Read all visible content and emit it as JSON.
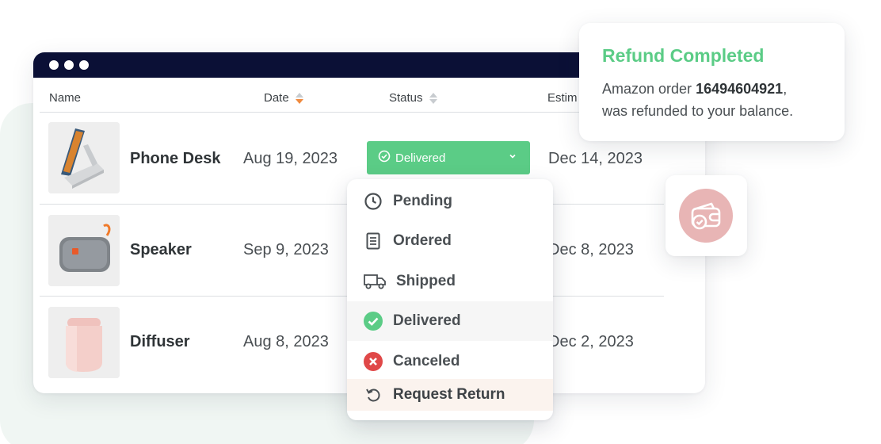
{
  "table": {
    "headers": {
      "name": "Name",
      "date": "Date",
      "status": "Status",
      "estimated": "Estim"
    },
    "rows": [
      {
        "name": "Phone Desk",
        "date": "Aug 19, 2023",
        "estimated": "Dec 14, 2023"
      },
      {
        "name": "Speaker",
        "date": "Sep 9, 2023",
        "estimated": "Dec 8, 2023"
      },
      {
        "name": "Diffuser",
        "date": "Aug 8, 2023",
        "estimated": "Dec 2, 2023"
      }
    ],
    "selected_status": "Delivered"
  },
  "status_menu": {
    "items": [
      {
        "label": "Pending",
        "icon": "clock-icon"
      },
      {
        "label": "Ordered",
        "icon": "clipboard-icon"
      },
      {
        "label": "Shipped",
        "icon": "truck-icon"
      },
      {
        "label": "Delivered",
        "icon": "check-circle-icon"
      },
      {
        "label": "Canceled",
        "icon": "x-circle-icon"
      },
      {
        "label": "Request Return",
        "icon": "undo-icon"
      }
    ]
  },
  "toast": {
    "title": "Refund Completed",
    "prefix": "Amazon order ",
    "order_number": "16494604921",
    "suffix": ",",
    "line2": "was refunded to your balance."
  },
  "colors": {
    "accent_green": "#5bcc86",
    "titlebar": "#0b1036",
    "cancel_red": "#e04848",
    "wallet_pink": "#e8b5b5"
  }
}
